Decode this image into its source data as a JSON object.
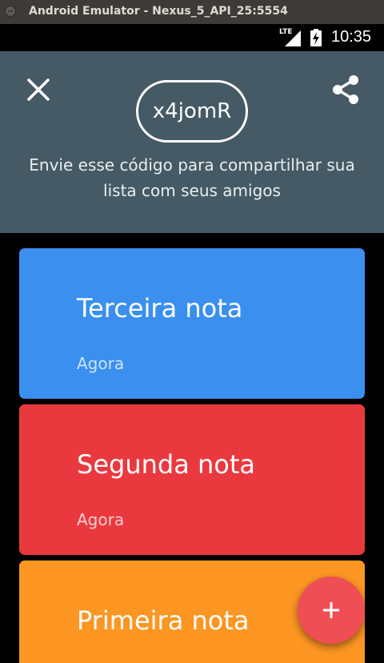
{
  "window": {
    "title": "Android Emulator - Nexus_5_API_25:5554"
  },
  "status_bar": {
    "network": "LTE",
    "time": "10:35"
  },
  "header": {
    "code": "x4jomR",
    "description": "Envie esse código para compartilhar sua lista com seus amigos",
    "background": "#455a64"
  },
  "notes": [
    {
      "title": "Terceira nota",
      "time": "Agora",
      "color": "#3a8fef"
    },
    {
      "title": "Segunda nota",
      "time": "Agora",
      "color": "#e9393f"
    },
    {
      "title": "Primeira nota",
      "time": "",
      "color": "#fe9623"
    }
  ],
  "fab": {
    "icon": "plus-icon",
    "color": "#ef4f54"
  },
  "icons": {
    "close": "close-icon",
    "share": "share-icon"
  }
}
